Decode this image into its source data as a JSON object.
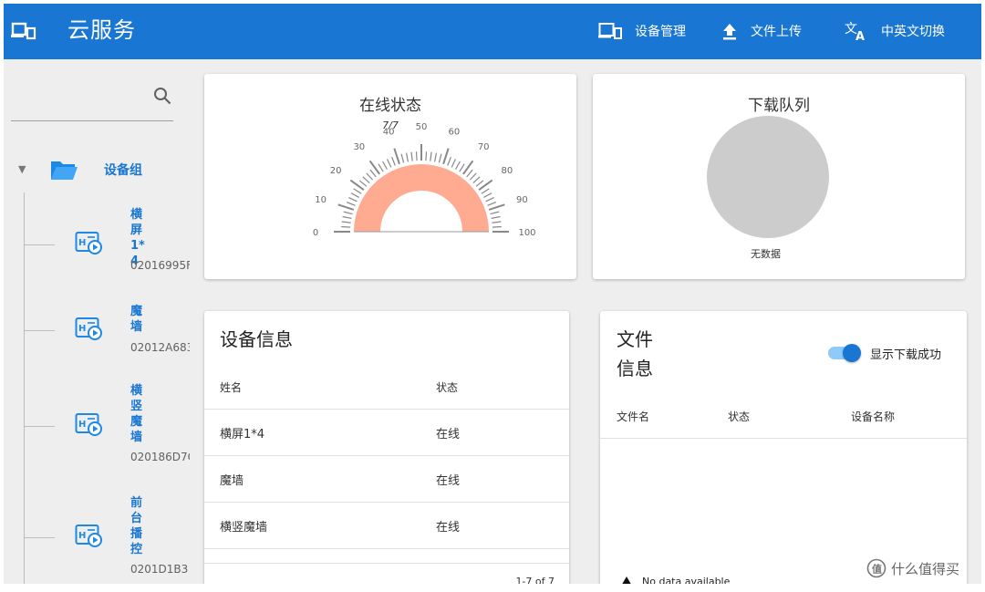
{
  "topbar": {
    "title": "云服务",
    "nav": [
      {
        "label": "设备管理",
        "icon": "device-manage-icon"
      },
      {
        "label": "文件上传",
        "icon": "upload-icon"
      },
      {
        "label": "中英文切换",
        "icon": "translate-icon"
      }
    ],
    "color": "#1976d2"
  },
  "sidebar": {
    "group_label": "设备组",
    "devices": [
      {
        "name": "横屏1*4",
        "id": "02016995F"
      },
      {
        "name": "魔墙",
        "id": "02012A683"
      },
      {
        "name": "横竖魔墙",
        "id": "020186D7C"
      },
      {
        "name": "前台播控",
        "id": "0201D1B3"
      }
    ]
  },
  "online_status": {
    "title": "在线状态",
    "ratio_label": "7/7",
    "percent_label": "100 %",
    "percent": 100,
    "ticks": [
      "0",
      "10",
      "20",
      "30",
      "40",
      "50",
      "60",
      "70",
      "80",
      "90",
      "100"
    ],
    "gauge_color": "#ffab91"
  },
  "download_queue": {
    "title": "下载队列",
    "empty_label": "无数据",
    "pie_color": "#cccccc"
  },
  "device_info": {
    "title": "设备信息",
    "columns": [
      "姓名",
      "状态"
    ],
    "rows": [
      {
        "name": "横屏1*4",
        "status": "在线"
      },
      {
        "name": "魔墙",
        "status": "在线"
      },
      {
        "name": "横竖魔墙",
        "status": "在线"
      }
    ],
    "pagination": "1-7 of 7"
  },
  "file_info": {
    "title": "文件信息",
    "toggle_label": "显示下载成功",
    "toggle_on": true,
    "columns": [
      "文件名",
      "状态",
      "设备名称"
    ],
    "empty_text": "No data available"
  },
  "watermark": "什么值得买"
}
